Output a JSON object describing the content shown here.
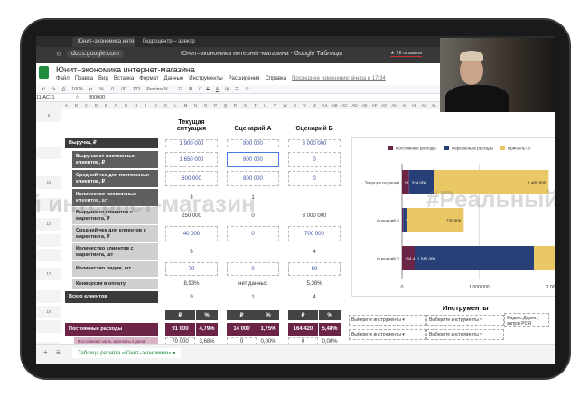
{
  "browser": {
    "tabs": [
      "Юнит–экономика интернет-магаз",
      "Гидроцентр – электр"
    ],
    "url": "docs.google.com",
    "window_title": "Юнит–экономика интернет-магазина - Google Таблицы",
    "reviews": "★ 2К отзывов"
  },
  "doc": {
    "title": "Юнит–экономика интернет-магазина",
    "menu": [
      "Файл",
      "Правка",
      "Вид",
      "Вставка",
      "Формат",
      "Данные",
      "Инструменты",
      "Расширения",
      "Справка"
    ],
    "last_edit": "Последнее изменение: вчера в 17:34"
  },
  "toolbar": {
    "zoom": "100%",
    "currency": "р.",
    "percent": "%",
    "dec1": ".0",
    "dec2": ".00",
    "format": "123",
    "font": "Proxima N...",
    "size": "12",
    "bold": "B",
    "italic": "I",
    "strike": "S",
    "color": "A"
  },
  "formula": {
    "cell_ref": "11:AC11",
    "fx": "fx",
    "value": "800000"
  },
  "columns": [
    "A",
    "B",
    "C",
    "D",
    "E",
    "F",
    "G",
    "H",
    "I",
    "J",
    "K",
    "L",
    "M",
    "N",
    "O",
    "P",
    "Q",
    "R",
    "S",
    "T",
    "U",
    "V",
    "W",
    "X",
    "Y",
    "Z",
    "AA",
    "AB",
    "AC",
    "AD",
    "AE",
    "AF",
    "AG",
    "AH",
    "AI",
    "AJ",
    "AK",
    "AL",
    "AM",
    "AN",
    "AO",
    "AP",
    "AQ",
    "AR",
    "AS",
    "AT",
    "AU",
    "AV",
    "AW",
    "AX"
  ],
  "row_numbers": [
    "6",
    "",
    "11",
    "",
    "13",
    "",
    "",
    "17",
    "",
    "19",
    "",
    "21",
    "",
    "",
    "",
    "",
    "31",
    "32",
    "33"
  ],
  "headers": [
    "Текущая ситуация",
    "Сценарий А",
    "Сценарий Б"
  ],
  "rows": [
    {
      "label": "Выручка, ₽",
      "style": "d1",
      "values": [
        "1 900 000",
        "800 000",
        "3 000 000"
      ],
      "input": true
    },
    {
      "label": "Выручка от постоянных клиентов, ₽",
      "style": "d2",
      "values": [
        "1 650 000",
        "800 000",
        "0"
      ],
      "input": true
    },
    {
      "label": "Средний чек для постоянных клиентов, ₽",
      "style": "d2",
      "values": [
        "600 000",
        "800 000",
        "0"
      ],
      "input": true
    },
    {
      "label": "Количество постоянных клиентов, шт",
      "style": "d2",
      "values": [
        "3",
        "1",
        ""
      ],
      "input": false
    },
    {
      "label": "Выручка от клиентов с маркетинга, ₽",
      "style": "d3",
      "values": [
        "250 000",
        "0",
        "3 000 000"
      ],
      "input": false
    },
    {
      "label": "Средний чек для клиентов с маркетинга, ₽",
      "style": "d3",
      "values": [
        "40 000",
        "0",
        "700 000"
      ],
      "input": true
    },
    {
      "label": "Количество клиентов с маркетинга, шт",
      "style": "d3",
      "values": [
        "6",
        "",
        "4"
      ],
      "input": false
    },
    {
      "label": "Количество лидов, шт",
      "style": "d3",
      "values": [
        "70",
        "0",
        "80"
      ],
      "input": true
    },
    {
      "label": "Конверсия в оплату",
      "style": "d3",
      "values": [
        "8,93%",
        "нет данных",
        "5,36%"
      ],
      "input": false
    },
    {
      "label": "Всего клиентов",
      "style": "d1",
      "values": [
        "9",
        "1",
        "4"
      ],
      "input": false
    }
  ],
  "cost_headers": [
    "₽",
    "%"
  ],
  "fixed_costs": {
    "label": "Постоянные расходы",
    "values": [
      [
        "91 000",
        "4,79%"
      ],
      [
        "14 000",
        "1,75%"
      ],
      [
        "164 420",
        "5,48%"
      ]
    ]
  },
  "salary": {
    "label": "Постоянная часть зарплаты отдела",
    "values": [
      [
        "70 000",
        "3,68%"
      ],
      [
        "0",
        "0,00%"
      ],
      [
        "0",
        "0,00%"
      ]
    ]
  },
  "chart_data": {
    "type": "bar",
    "orientation": "horizontal",
    "stacked": true,
    "categories": [
      "Текущая ситуация",
      "Сценарий А",
      "Сценарий Б"
    ],
    "series": [
      {
        "name": "Постоянные расходы",
        "color": "#6b2445",
        "values": [
          91000,
          14000,
          164420
        ]
      },
      {
        "name": "Переменные расходы",
        "color": "#27407a",
        "values": [
          324000,
          56000,
          1545000
        ]
      },
      {
        "name": "Прибыль / У",
        "color": "#e8c764",
        "values": [
          1485000,
          730000,
          1290580
        ]
      }
    ],
    "data_labels": [
      [
        "91 000",
        "324 000",
        "1 485 000"
      ],
      [
        "14 000",
        "56 000",
        "730 000"
      ],
      [
        "164 420",
        "1 545 000",
        ""
      ]
    ],
    "x_ticks": [
      "0",
      "1 000 000",
      "2 000 000"
    ],
    "xlim": [
      0,
      2400000
    ],
    "legend": "top",
    "grid": true
  },
  "instruments": {
    "title": "Инструменты",
    "placeholder": "Выберите инструменты",
    "side": "Яндекс.Директ, запуск РСЯ"
  },
  "sheet_tab": "Таблица расчёта «Юнит–экономики»",
  "watermarks": [
    "й интернет-магазин",
    "#Реальный"
  ]
}
